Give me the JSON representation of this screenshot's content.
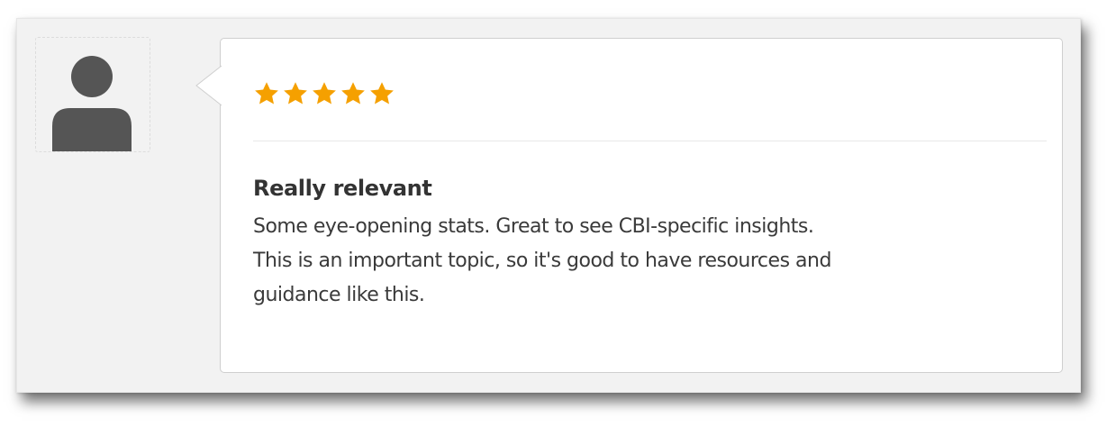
{
  "review": {
    "avatar_icon": "user-silhouette-icon",
    "rating": 5,
    "max_rating": 5,
    "star_color": "#f5a000",
    "title": "Really relevant",
    "body": "Some eye-opening stats. Great to see CBI-specific insights.\nThis is an important topic, so it's good to have resources and\nguidance like this."
  }
}
